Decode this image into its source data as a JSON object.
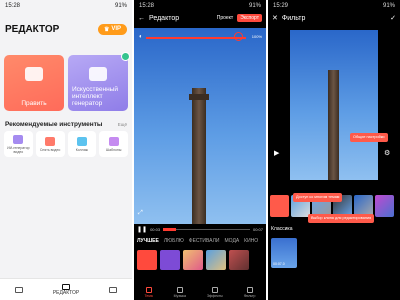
{
  "screen1": {
    "status_time": "15:28",
    "status_right": "91%",
    "title": "РЕДАКТОР",
    "vip_label": "VIP",
    "cards": [
      {
        "label": "Править"
      },
      {
        "label": "Искусственный интеллект генератор"
      }
    ],
    "recommended_title": "Рекомендуемые инструменты",
    "more_label": "Ещё",
    "tools": [
      {
        "label": "ИИ-генератор видео"
      },
      {
        "label": "Снять видео"
      },
      {
        "label": "Коллаж"
      },
      {
        "label": "Шаблоны"
      }
    ],
    "nav_label": "РЕДАКТОР"
  },
  "screen2": {
    "status_time": "15:28",
    "status_right": "91%",
    "title": "Редактор",
    "project_label": "Проект",
    "export_label": "Экспорт",
    "zoom": "100%",
    "time_current": "00:03",
    "time_total": "00:07",
    "categories": [
      "ЛУЧШЕЕ",
      "ЛЮБЛЮ",
      "ФЕСТИВАЛИ",
      "МОДА",
      "КИНО"
    ],
    "tools": [
      {
        "label": "Тема"
      },
      {
        "label": "Музыка"
      },
      {
        "label": "Эффекты"
      },
      {
        "label": "Фильтр"
      }
    ]
  },
  "screen3": {
    "status_time": "15:29",
    "status_right": "91%",
    "title": "Фильтр",
    "tip_general": "Общие настройки",
    "tip_add": "Доступ ко многим темам",
    "tip_select": "Выбор клипа для редактирования",
    "category": "Классика",
    "clip_time": "00:07.0"
  }
}
